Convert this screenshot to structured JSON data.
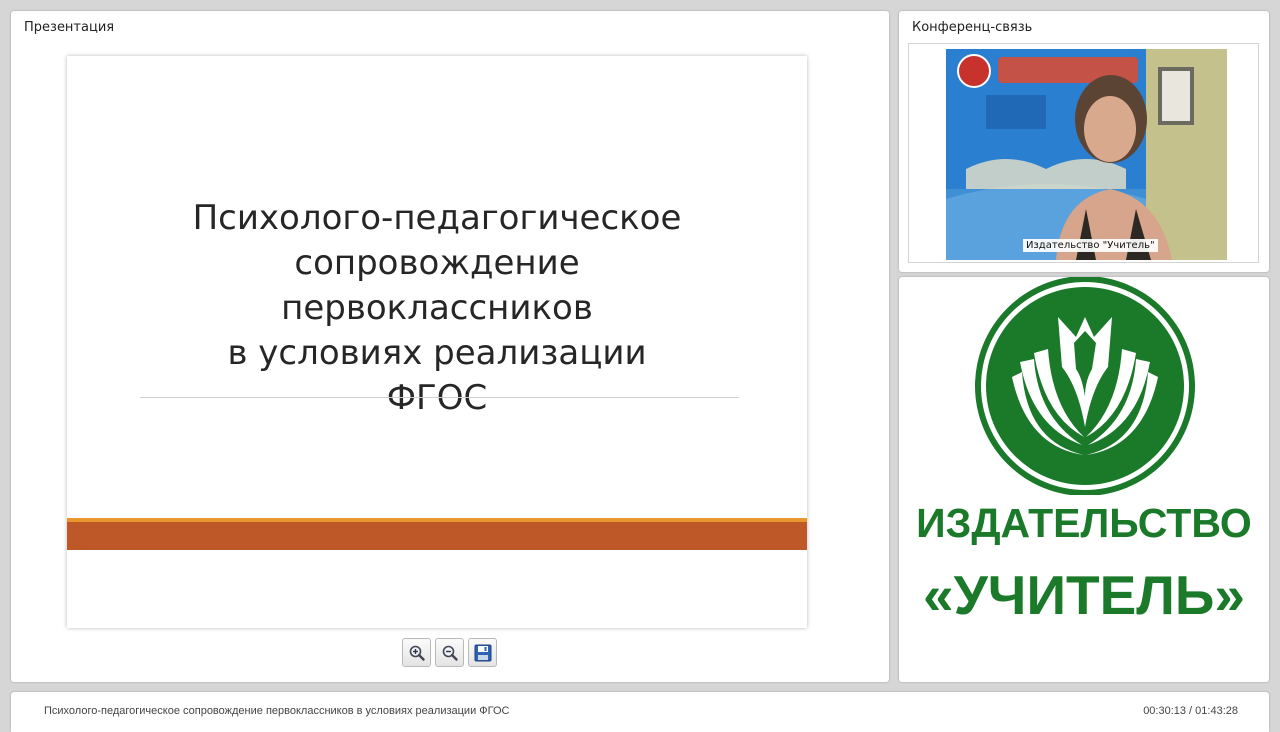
{
  "presentation": {
    "title": "Презентация",
    "slide": {
      "title_lines": [
        "Психолого-педагогическое",
        "сопровождение",
        "первоклассников",
        "в условиях реализации",
        "ФГОС"
      ]
    },
    "toolbar": {
      "zoom_in_icon": "zoom-in-icon",
      "zoom_out_icon": "zoom-out-icon",
      "save_icon": "save-icon"
    }
  },
  "conference": {
    "title": "Конференц-связь",
    "video_caption": "Издательство \"Учитель\""
  },
  "logo": {
    "line1": "ИЗДАТЕЛЬСТВО",
    "line2": "«УЧИТЕЛЬ»",
    "brand_color": "#1a7a2a"
  },
  "bottom": {
    "title": "Психолого-педагогическое сопровождение первоклассников в условиях реализации ФГОС",
    "time": "00:30:13 / 01:43:28"
  },
  "colors": {
    "background": "#d6d6d6",
    "slide_stripe": "#bf5829",
    "slide_stripe_accent": "#e9962e"
  }
}
